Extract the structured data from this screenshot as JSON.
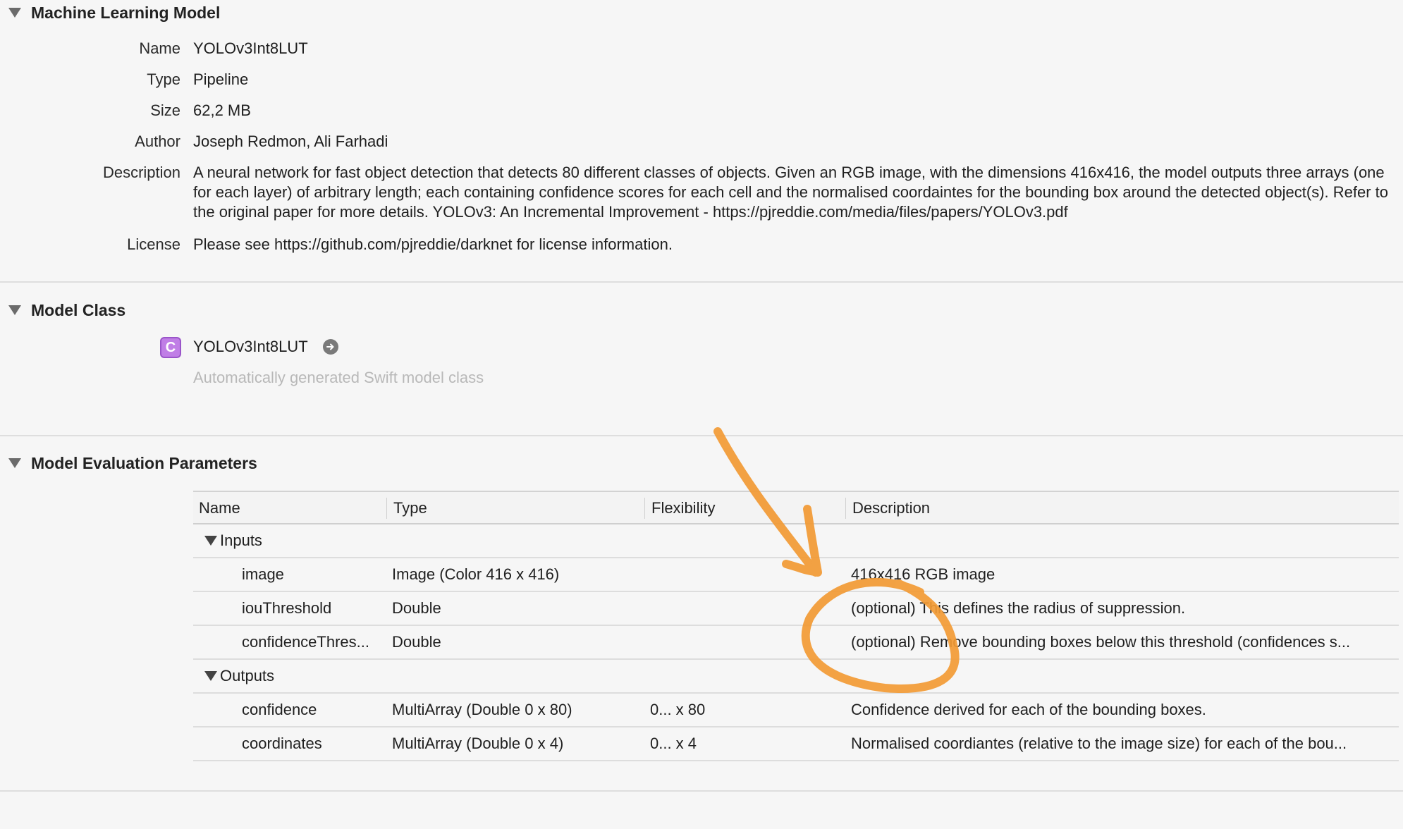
{
  "ml_model": {
    "title": "Machine Learning Model",
    "fields": [
      {
        "label": "Name",
        "value": "YOLOv3Int8LUT"
      },
      {
        "label": "Type",
        "value": "Pipeline"
      },
      {
        "label": "Size",
        "value": "62,2 MB"
      },
      {
        "label": "Author",
        "value": "Joseph Redmon, Ali Farhadi"
      },
      {
        "label": "Description",
        "value": "A neural network for fast object detection that detects 80 different classes of objects. Given an RGB image, with the dimensions 416x416, the model outputs three arrays (one for each layer) of arbitrary length; each containing confidence scores for each cell and the normalised coordaintes for the bounding box around the detected object(s). Refer to the original paper for more details. YOLOv3: An Incremental Improvement - https://pjreddie.com/media/files/papers/YOLOv3.pdf"
      },
      {
        "label": "License",
        "value": "Please see https://github.com/pjreddie/darknet for license information."
      }
    ]
  },
  "model_class": {
    "title": "Model Class",
    "badge": "C",
    "class_name": "YOLOv3Int8LUT",
    "subtitle": "Automatically generated Swift model class"
  },
  "eval_params": {
    "title": "Model Evaluation Parameters",
    "columns": [
      "Name",
      "Type",
      "Flexibility",
      "Description"
    ],
    "inputs_label": "Inputs",
    "outputs_label": "Outputs",
    "inputs": [
      {
        "name": "image",
        "type": "Image (Color 416 x 416)",
        "flexibility": "",
        "description": "416x416 RGB image"
      },
      {
        "name": "iouThreshold",
        "type": "Double",
        "flexibility": "",
        "description": "(optional) This defines the radius of suppression."
      },
      {
        "name": "confidenceThres...",
        "type": "Double",
        "flexibility": "",
        "description": "(optional) Remove bounding boxes below this threshold (confidences s..."
      }
    ],
    "outputs": [
      {
        "name": "confidence",
        "type": "MultiArray (Double 0 x 80)",
        "flexibility": "0... x 80",
        "description": "Confidence derived for each of the bounding boxes."
      },
      {
        "name": "coordinates",
        "type": "MultiArray (Double 0 x 4)",
        "flexibility": "0... x 4",
        "description": "Normalised coordiantes (relative to the image size) for each of the bou..."
      }
    ]
  },
  "annotation_color": "#f29a34",
  "icons": [
    "disclosure-triangle-icon",
    "class-badge-icon",
    "arrow-circle-right-icon"
  ]
}
